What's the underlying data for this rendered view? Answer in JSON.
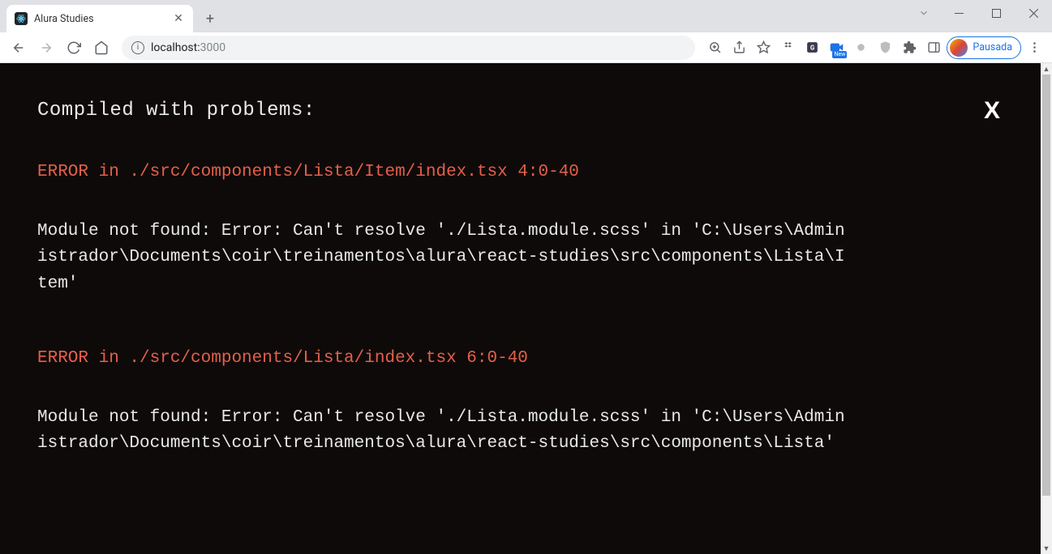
{
  "window": {
    "title": "Alura Studies"
  },
  "tab": {
    "title": "Alura Studies"
  },
  "address": {
    "host": "localhost:",
    "port": "3000"
  },
  "profile": {
    "label": "Pausada"
  },
  "ext_badge": "New",
  "overlay": {
    "heading": "Compiled with problems:",
    "close": "X",
    "errors": [
      {
        "title": "ERROR in ./src/components/Lista/Item/index.tsx 4:0-40",
        "body": "Module not found: Error: Can't resolve './Lista.module.scss' in 'C:\\Users\\Administrador\\Documents\\coir\\treinamentos\\alura\\react-studies\\src\\components\\Lista\\Item'"
      },
      {
        "title": "ERROR in ./src/components/Lista/index.tsx 6:0-40",
        "body": "Module not found: Error: Can't resolve './Lista.module.scss' in 'C:\\Users\\Administrador\\Documents\\coir\\treinamentos\\alura\\react-studies\\src\\components\\Lista'"
      }
    ]
  }
}
